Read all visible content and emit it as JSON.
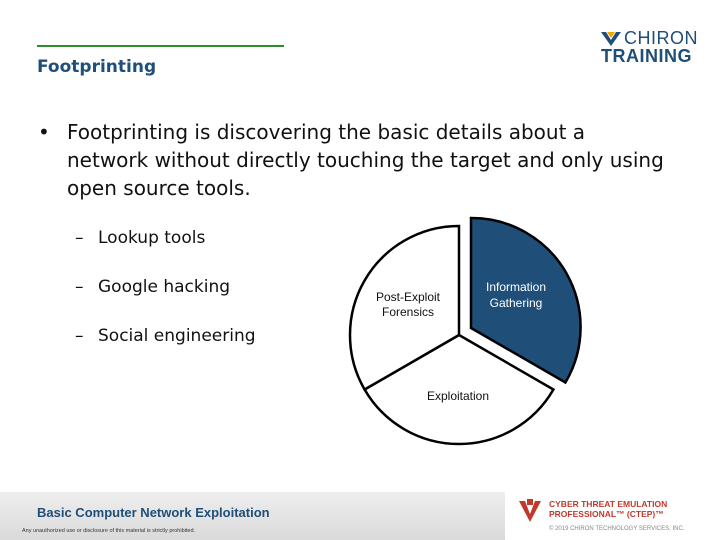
{
  "header": {
    "slide_title": "Footprinting",
    "logo_line1": "CHIRON",
    "logo_line2": "TRAINING"
  },
  "content": {
    "main_bullet": "Footprinting is discovering the basic details about a network without directly touching the target and only using open source tools.",
    "sub_bullets": [
      "Lookup tools",
      "Google hacking",
      "Social engineering"
    ]
  },
  "diagram": {
    "segments": [
      {
        "label_line1": "Information",
        "label_line2": "Gathering",
        "highlighted": true
      },
      {
        "label_line1": "Exploitation",
        "label_line2": "",
        "highlighted": false
      },
      {
        "label_line1": "Post-Exploit",
        "label_line2": "Forensics",
        "highlighted": false
      }
    ],
    "colors": {
      "highlight": "#1f4e79",
      "plain": "#ffffff"
    }
  },
  "footer": {
    "course_title": "Basic Computer Network Exploitation",
    "disclaimer": "Any unauthorized use or disclosure of this material is strictly prohibited.",
    "brand_line1": "CYBER THREAT EMULATION",
    "brand_line2": "PROFESSIONAL™ (CTEP)™",
    "copyright": "© 2019 CHIRON TECHNOLOGY SERVICES, INC."
  },
  "colors": {
    "title_blue": "#1f4e79",
    "rule_green": "#2e8b2e",
    "brand_red": "#c0392b"
  }
}
